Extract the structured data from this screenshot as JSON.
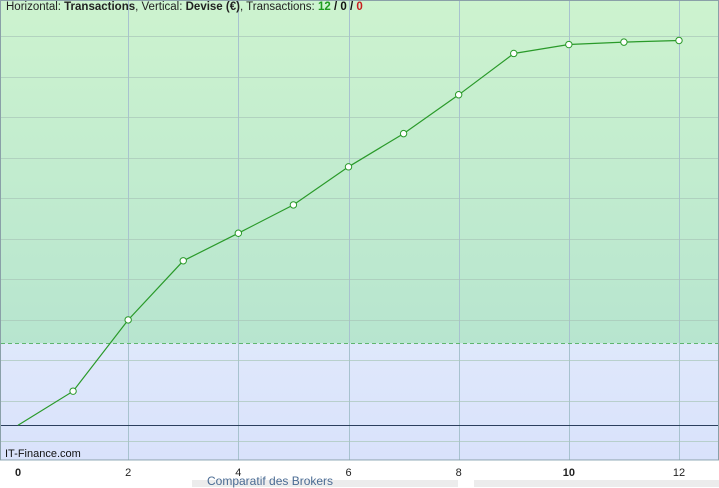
{
  "header": {
    "prefix_horizontal": "Horizontal: ",
    "horizontal": "Transactions",
    "prefix_vertical": ", Vertical: ",
    "vertical": "Devise (€)",
    "prefix_transactions": ", Transactions: ",
    "count_green": "12",
    "sep1": " / ",
    "count_black": "0",
    "sep2": " / ",
    "count_red": "0"
  },
  "watermark": "IT-Finance.com",
  "bottom_text": "Comparatif des Brokers",
  "colors": {
    "profit_zone": "#c3eccc",
    "loss_zone": "#dde6fb",
    "line": "#2a9a2a",
    "count_green": "#1f9a1f",
    "count_red": "#c81e1e"
  },
  "chart_data": {
    "type": "line",
    "x": [
      0,
      1,
      2,
      3,
      4,
      5,
      6,
      7,
      8,
      9,
      10,
      11,
      12
    ],
    "series": [
      {
        "values": [
          0,
          42,
          130,
          203,
          237,
          272,
          319,
          360,
          408,
          459,
          470,
          473,
          475
        ]
      }
    ],
    "xlim": [
      0,
      12.7
    ],
    "ylim": [
      -43,
      525
    ],
    "xticks": [
      0,
      2,
      4,
      6,
      8,
      10,
      12
    ],
    "bold_ticks": [
      0,
      10
    ],
    "baseline": 0,
    "threshold": 101,
    "grid": true,
    "markers": "hollow-circle"
  }
}
